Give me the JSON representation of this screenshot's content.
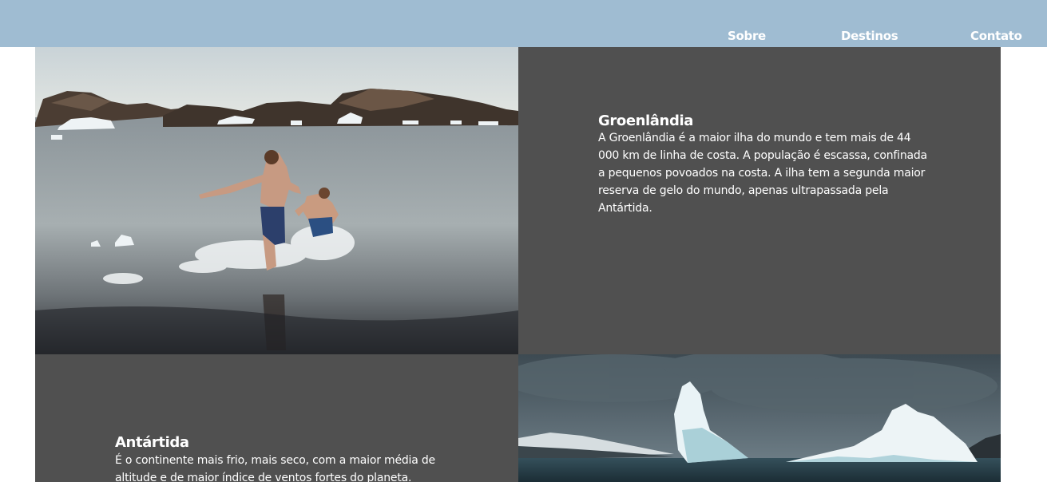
{
  "nav": {
    "items": [
      {
        "label": "Sobre"
      },
      {
        "label": "Destinos"
      },
      {
        "label": "Contato"
      }
    ]
  },
  "destinations": [
    {
      "title": "Groenlândia",
      "text": "A Groenlândia é a maior ilha do mundo e tem mais de 44 000 km de linha de costa. A população é escassa, confinada a pequenos povoados na costa. A ilha tem a segunda maior reserva de gelo do mundo, apenas ultrapassada pela Antártida.",
      "image": "swimmers-in-arctic-water-photo"
    },
    {
      "title": "Antártida",
      "text": "É o continente mais frio, mais seco, com a maior média de altitude e de maior índice de ventos fortes do planeta.",
      "image": "antarctic-icebergs-photo"
    }
  ],
  "colors": {
    "header": "#9fbcd2",
    "panel": "#505050",
    "text": "#ffffff"
  }
}
